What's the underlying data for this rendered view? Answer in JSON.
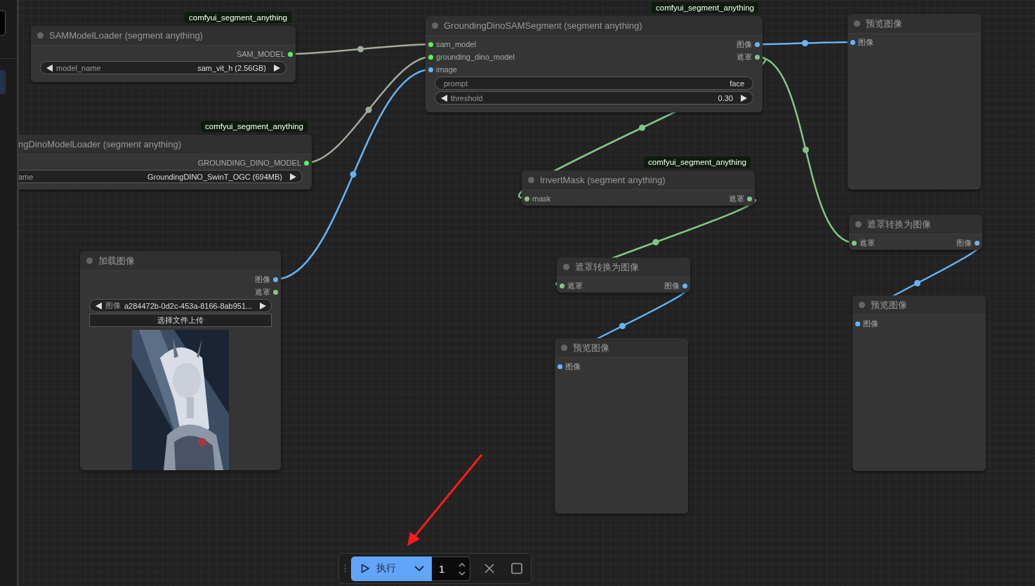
{
  "canvas": {
    "nodes": [
      {
        "title": "SAMModelLoader (segment anything)",
        "badge": "comfyui_segment_anything",
        "outputs": [
          {
            "label": "SAM_MODEL",
            "kind": "model"
          }
        ],
        "widgets": [
          {
            "kind": "combo",
            "label": "model_name",
            "value": "sam_vit_h (2.56GB)"
          }
        ]
      },
      {
        "title": "ngDinoModelLoader (segment anything)",
        "badge": "comfyui_segment_anything",
        "cut_left": true,
        "outputs": [
          {
            "label": "GROUNDING_DINO_MODEL",
            "kind": "model"
          }
        ],
        "widgets": [
          {
            "kind": "combo",
            "label": "ame",
            "value": "GroundingDINO_SwinT_OGC (694MB)"
          }
        ]
      },
      {
        "title": "GroundingDinoSAMSegment (segment anything)",
        "badge": "comfyui_segment_anything",
        "inputs": [
          {
            "label": "sam_model",
            "kind": "model"
          },
          {
            "label": "grounding_dino_model",
            "kind": "model"
          },
          {
            "label": "image"
          }
        ],
        "outputs": [
          {
            "label": "图像"
          },
          {
            "label": "遮罩",
            "kind": "mask"
          }
        ],
        "widgets": [
          {
            "kind": "text",
            "label": "prompt",
            "value": "face"
          },
          {
            "kind": "combo",
            "label": "threshold",
            "value": "0.30"
          }
        ]
      },
      {
        "title": "预览图像",
        "inputs": [
          {
            "label": "图像"
          }
        ]
      },
      {
        "title": "InvertMask (segment anything)",
        "badge": "comfyui_segment_anything",
        "inputs": [
          {
            "label": "mask",
            "kind": "mask"
          }
        ],
        "outputs": [
          {
            "label": "遮罩",
            "kind": "mask"
          }
        ]
      },
      {
        "title": "遮罩转换为图像",
        "inputs": [
          {
            "label": "遮罩",
            "kind": "mask"
          }
        ],
        "outputs": [
          {
            "label": "图像"
          }
        ]
      },
      {
        "title": "加载图像",
        "outputs": [
          {
            "label": "图像"
          },
          {
            "label": "遮罩",
            "kind": "mask"
          }
        ],
        "widgets": [
          {
            "kind": "combo",
            "label": "图像",
            "value": "a284472b-0d2c-453a-8166-8ab951..."
          },
          {
            "kind": "button",
            "label": "选择文件上传"
          }
        ],
        "preview": {
          "kind": "picture"
        }
      },
      {
        "title": "遮罩转换为图像",
        "inputs": [
          {
            "label": "遮罩",
            "kind": "mask"
          }
        ],
        "outputs": [
          {
            "label": "图像"
          }
        ]
      },
      {
        "title": "预览图像",
        "inputs": [
          {
            "label": "图像"
          }
        ]
      },
      {
        "title": "预览图像",
        "inputs": [
          {
            "label": "图像"
          }
        ]
      }
    ]
  },
  "toolbar": {
    "run_label": "执行",
    "count": "1"
  }
}
